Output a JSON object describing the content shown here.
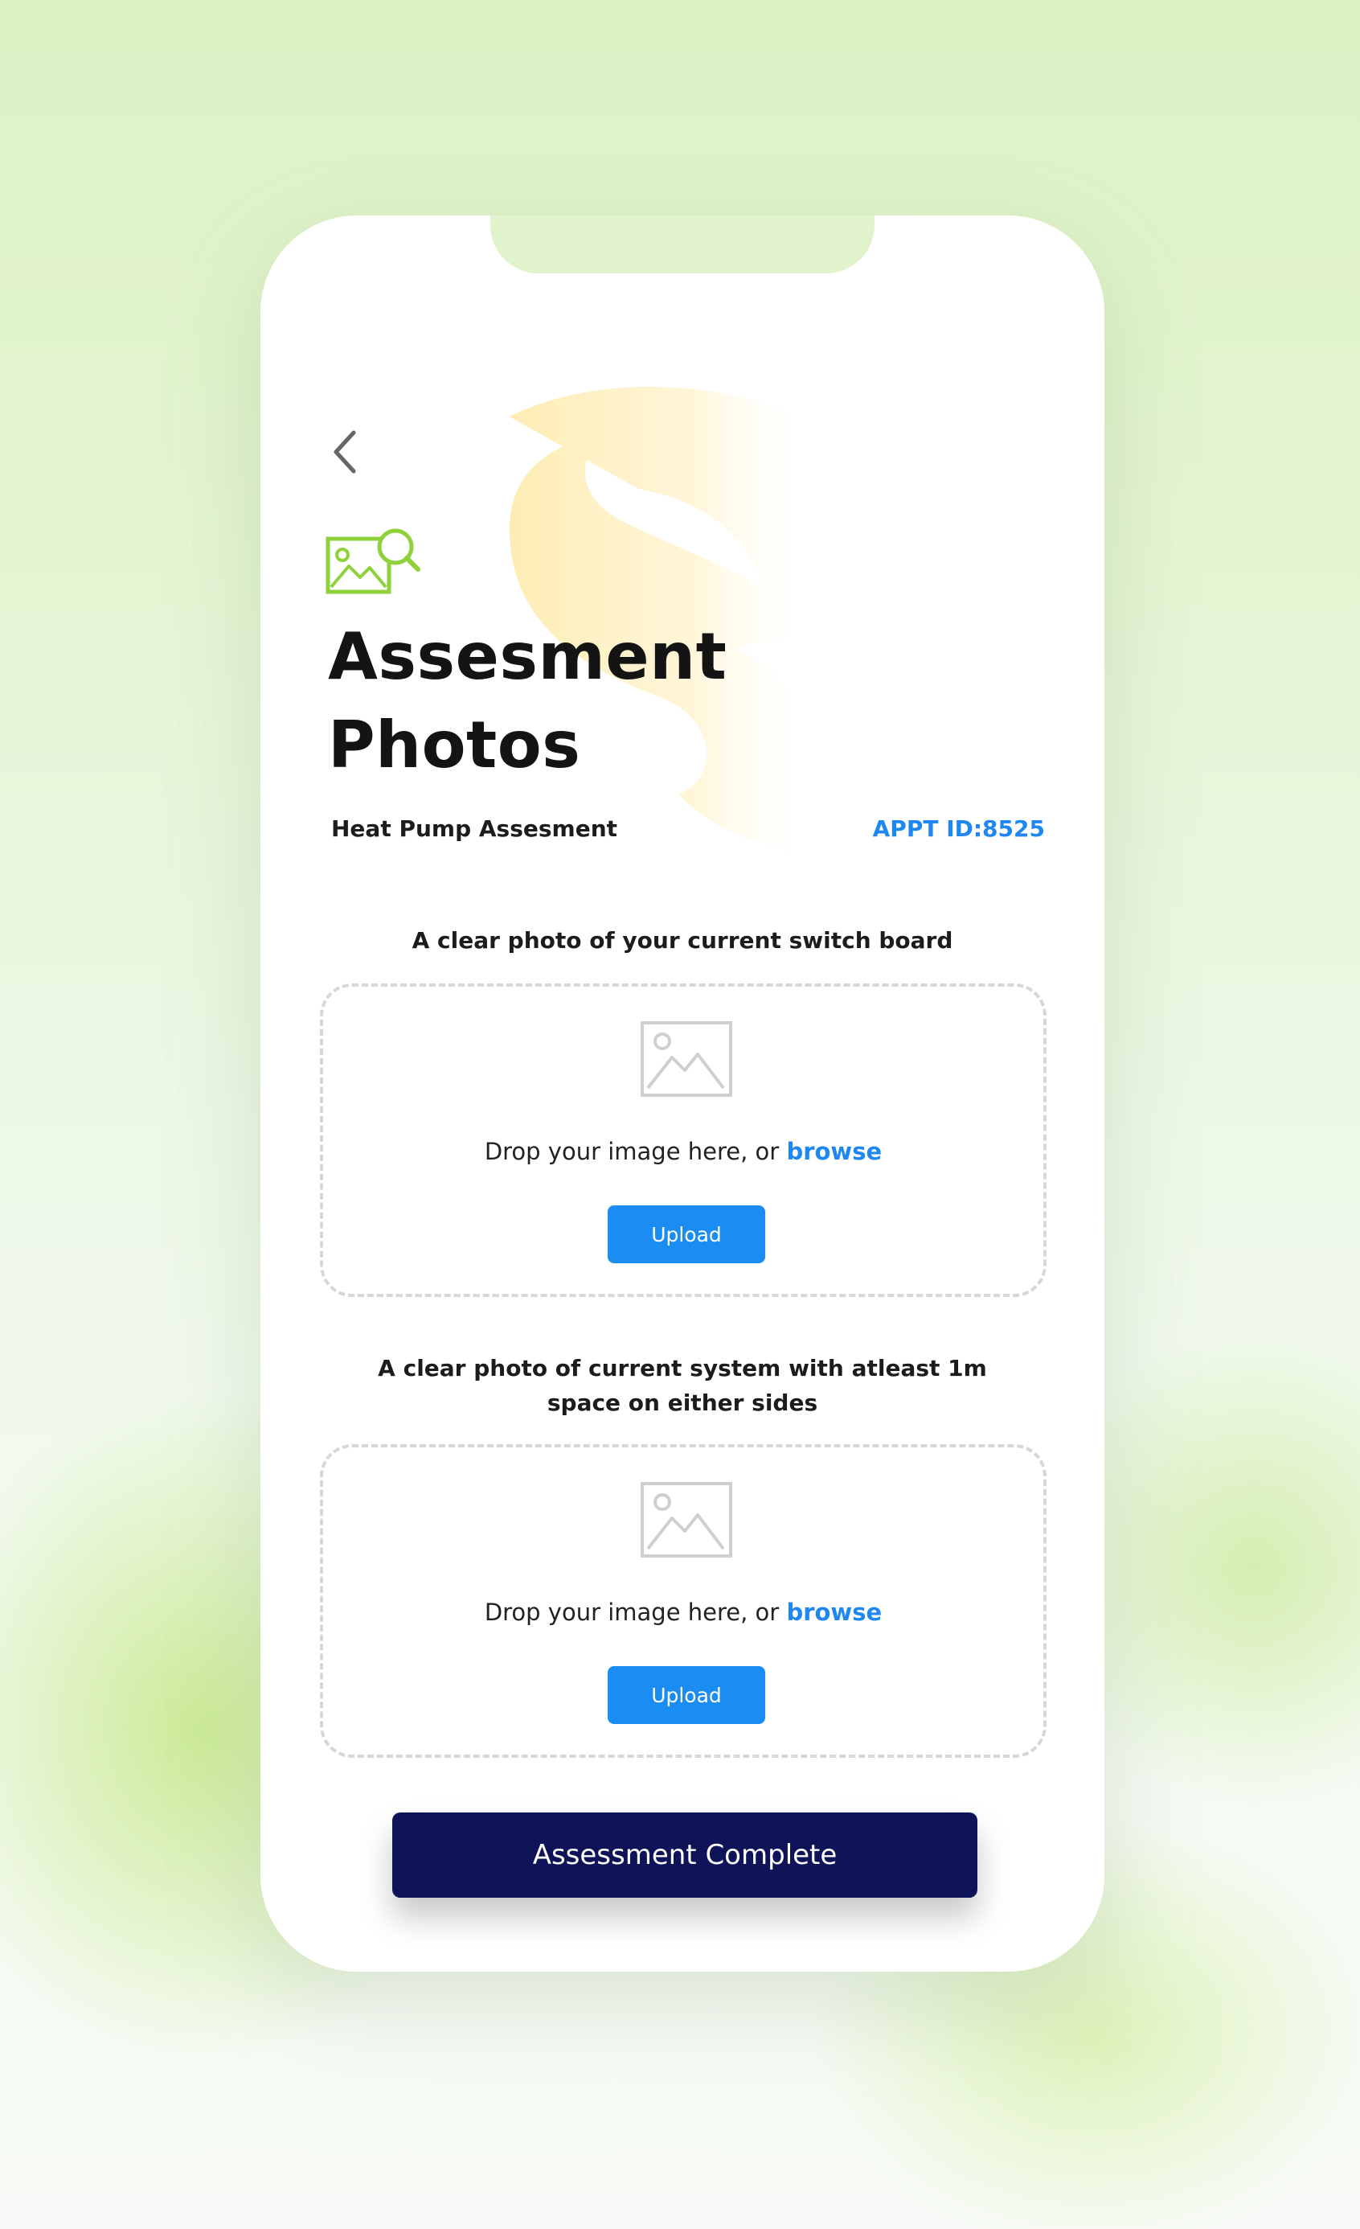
{
  "header": {
    "back_icon": "chevron-left-icon",
    "title_icon": "image-search-icon",
    "title_line1": "Assesment",
    "title_line2": "Photos",
    "subtitle": "Heat Pump Assesment",
    "appt_id": "APPT ID:8525"
  },
  "sections": [
    {
      "prompt": "A clear photo of your current switch board",
      "drop_text": "Drop your image here, or ",
      "browse_label": "browse",
      "upload_label": "Upload",
      "icon": "image-placeholder-icon"
    },
    {
      "prompt": "A clear photo of current system with atleast 1m space on either sides",
      "drop_text": "Drop your image here, or ",
      "browse_label": "browse",
      "upload_label": "Upload",
      "icon": "image-placeholder-icon"
    }
  ],
  "footer": {
    "complete_label": "Assessment Complete"
  },
  "colors": {
    "accent_blue": "#1b8cf2",
    "primary_navy": "#0e1457",
    "icon_green": "#8ed13a",
    "background_green": "#dcf2c4"
  }
}
